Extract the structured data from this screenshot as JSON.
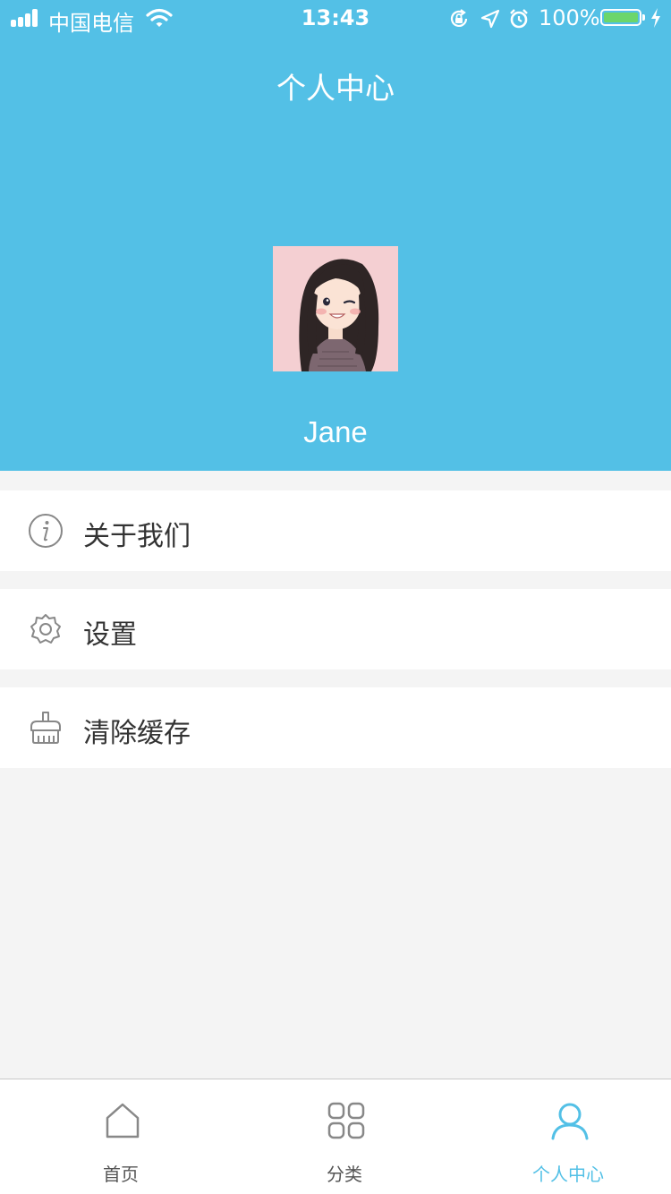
{
  "status_bar": {
    "carrier": "中国电信",
    "time": "13:43",
    "battery_percent": "100%",
    "signal_bars": 4,
    "battery_level": 1.0,
    "icons": [
      "wifi-icon",
      "rotation-lock-icon",
      "location-arrow-icon",
      "alarm-icon",
      "battery-icon",
      "charging-bolt-icon"
    ]
  },
  "header": {
    "title": "个人中心",
    "username": "Jane",
    "avatar": "avatar-illustration"
  },
  "menu": {
    "items": [
      {
        "label": "关于我们",
        "icon": "info-icon"
      },
      {
        "label": "设置",
        "icon": "gear-icon"
      },
      {
        "label": "清除缓存",
        "icon": "broom-icon"
      }
    ]
  },
  "tabbar": {
    "tabs": [
      {
        "label": "首页",
        "icon": "home-icon",
        "active": false
      },
      {
        "label": "分类",
        "icon": "category-grid-icon",
        "active": false
      },
      {
        "label": "个人中心",
        "icon": "user-icon",
        "active": true
      }
    ]
  },
  "colors": {
    "accent": "#53c0e6",
    "background": "#f4f4f4",
    "text": "#333333",
    "tab_inactive": "#555555",
    "battery_fill": "#6cd66b"
  }
}
